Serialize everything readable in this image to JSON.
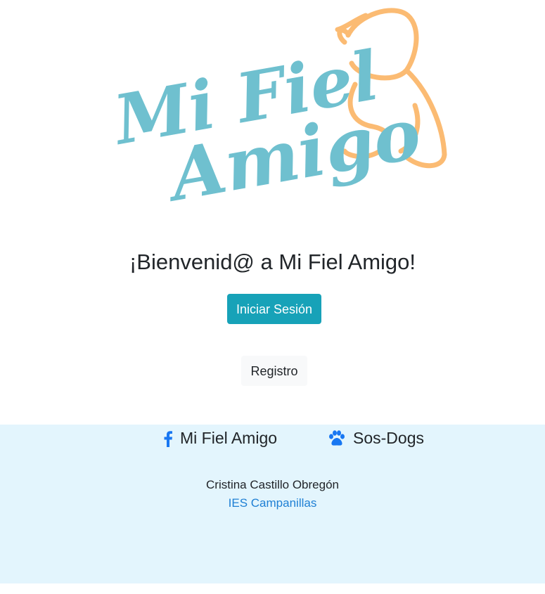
{
  "logo": {
    "line1": "Mi Fiel",
    "line2": "Amigo"
  },
  "heading": "¡Bienvenid@ a Mi Fiel Amigo!",
  "buttons": {
    "login": "Iniciar Sesión",
    "register": "Registro"
  },
  "footer": {
    "social": [
      {
        "icon": "facebook-icon",
        "label": "Mi Fiel Amigo"
      },
      {
        "icon": "paw-icon",
        "label": "Sos-Dogs"
      }
    ],
    "author": "Cristina Castillo Obregón",
    "school": "IES Campanillas"
  },
  "colors": {
    "primary": "#17a2b8",
    "logo_blue": "#6fc0cf",
    "logo_orange": "#fbbb73",
    "footer_bg": "#e3f5fd",
    "icon_blue": "#1877f2",
    "link": "#1e7fd4"
  }
}
